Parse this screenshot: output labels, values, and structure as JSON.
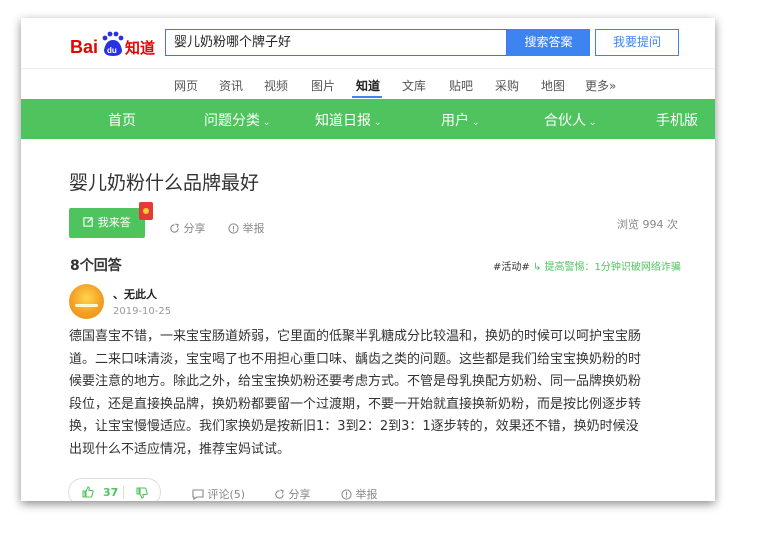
{
  "header": {
    "logo_text": "Bai du 知道",
    "search_value": "婴儿奶粉哪个牌子好",
    "search_button": "搜索答案",
    "ask_button": "我要提问"
  },
  "subnav": {
    "items": [
      "网页",
      "资讯",
      "视频",
      "图片",
      "知道",
      "文库",
      "贴吧",
      "采购",
      "地图",
      "更多»"
    ],
    "active": "知道"
  },
  "mainnav": {
    "items": [
      "首页",
      "问题分类",
      "知道日报",
      "用户",
      "合伙人",
      "手机版"
    ],
    "has_dropdown": [
      false,
      true,
      true,
      true,
      true,
      false
    ]
  },
  "question": {
    "title": "婴儿奶粉什么品牌最好",
    "answer_button": "我来答",
    "share": "分享",
    "report": "举报",
    "views": "浏览 994 次"
  },
  "answers_count": "8个回答",
  "activity": {
    "tag": "#活动#",
    "text": "提高警惕：1分钟识破网络诈骗"
  },
  "answer": {
    "username": "、无此人",
    "date": "2019-10-25",
    "lines": [
      "德国喜宝不错，一来宝宝肠道娇弱，它里面的低聚半乳糖成分比较温和，换奶的时候可以呵护宝宝肠",
      "道。二来口味清淡，宝宝喝了也不用担心重口味、龋齿之类的问题。这些都是我们给宝宝换奶粉的时",
      "候要注意的地方。除此之外，给宝宝换奶粉还要考虑方式。不管是母乳换配方奶粉、同一品牌换奶粉",
      "段位，还是直接换品牌，换奶粉都要留一个过渡期，不要一开始就直接换新奶粉，而是按比例逐步转",
      "换，让宝宝慢慢适应。我们家换奶是按新旧1：3到2：2到3：1逐步转的，效果还不错，换奶时候没",
      "出现什么不适应情况，推荐宝妈试试。"
    ],
    "likes": "37",
    "comment": "评论(5)",
    "share": "分享",
    "report": "举报"
  },
  "colors": {
    "green": "#4fc45e",
    "blue": "#3d84f0",
    "logo_red": "#e10601",
    "logo_blue": "#2932e1"
  }
}
